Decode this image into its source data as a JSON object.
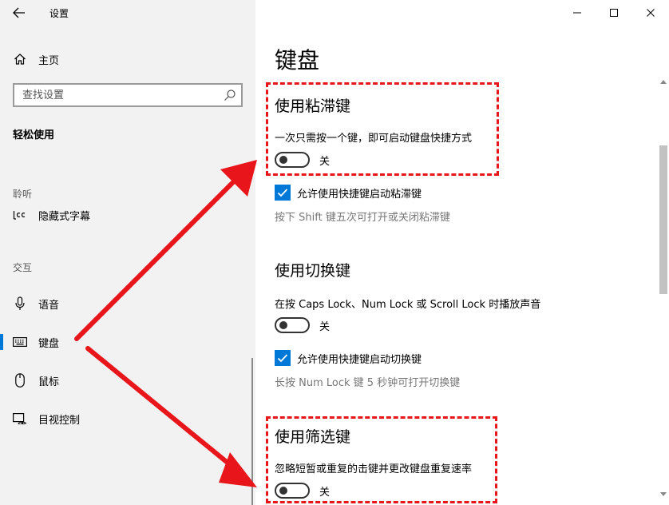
{
  "window": {
    "title": "设置"
  },
  "sidebar": {
    "home_label": "主页",
    "search_placeholder": "查找设置",
    "section_title": "轻松使用",
    "groups": [
      {
        "header": "聆听",
        "items": [
          {
            "label": "隐藏式字幕",
            "icon": "closed-captions-icon"
          }
        ]
      },
      {
        "header": "交互",
        "items": [
          {
            "label": "语音",
            "icon": "microphone-icon"
          },
          {
            "label": "键盘",
            "icon": "keyboard-icon",
            "active": true
          },
          {
            "label": "鼠标",
            "icon": "mouse-icon"
          },
          {
            "label": "目视控制",
            "icon": "eye-control-icon"
          }
        ]
      }
    ]
  },
  "main": {
    "page_title": "键盘",
    "sticky_keys": {
      "title": "使用粘滞键",
      "description": "一次只需按一个键，即可启动键盘快捷方式",
      "toggle_state": "关",
      "checkbox_label": "允许使用快捷键启动粘滞键",
      "hint": "按下 Shift 键五次可打开或关闭粘滞键"
    },
    "toggle_keys": {
      "title": "使用切换键",
      "description": "在按 Caps Lock、Num Lock 或 Scroll Lock 时播放声音",
      "toggle_state": "关",
      "checkbox_label": "允许使用快捷键启动切换键",
      "hint": "长按 Num Lock 键 5 秒钟可打开切换键"
    },
    "filter_keys": {
      "title": "使用筛选键",
      "description": "忽略短暂或重复的击键并更改键盘重复速率",
      "toggle_state": "关"
    }
  },
  "colors": {
    "accent": "#0078d7",
    "annotation": "#e8161b",
    "sidebar_bg": "#f2f2f2"
  }
}
